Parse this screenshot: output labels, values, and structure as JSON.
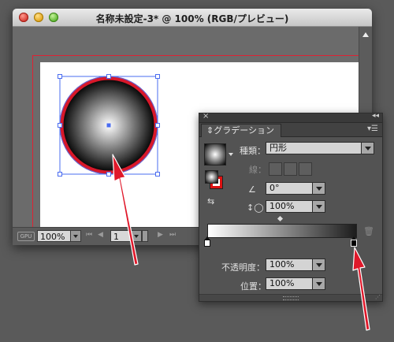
{
  "document": {
    "title": "名称未設定-3* @ 100% (RGB/プレビュー)",
    "zoom": "100%",
    "artboard": "1"
  },
  "gradient_panel": {
    "tab_label": "グラデーション",
    "type_label": "種類：",
    "type_value": "円形",
    "stroke_label": "線：",
    "angle_value": "0°",
    "aspect_value": "100%",
    "opacity_label": "不透明度：",
    "opacity_value": "100%",
    "location_label": "位置：",
    "location_value": "100%",
    "stops": [
      {
        "color": "#ffffff",
        "position": 0
      },
      {
        "color": "#000000",
        "position": 100
      }
    ]
  },
  "colors": {
    "accent_red": "#e0182a",
    "selection_blue": "#4060e0"
  }
}
